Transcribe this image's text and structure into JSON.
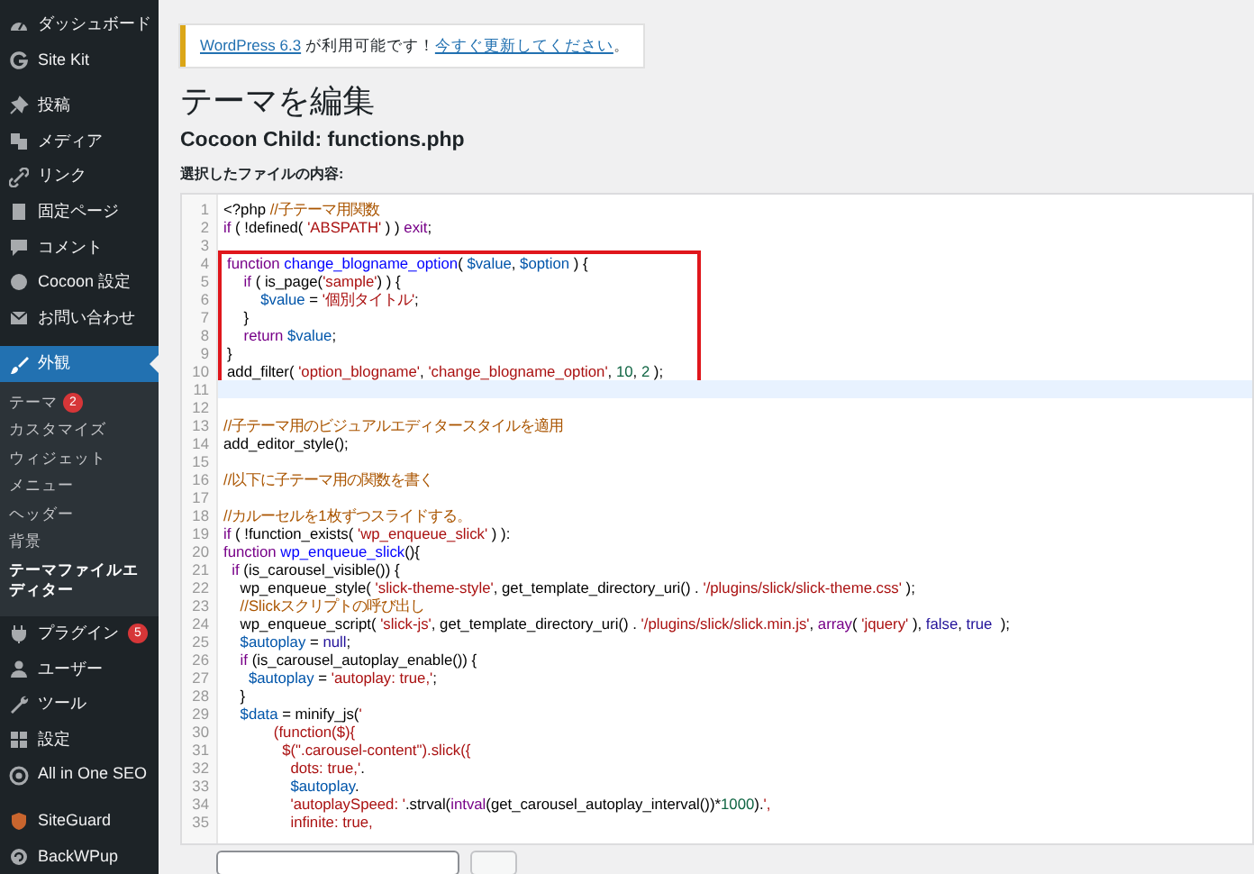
{
  "sidebar": {
    "groups": [
      {
        "items": [
          {
            "label": "ダッシュボード",
            "selected": false
          },
          {
            "label": "Site Kit",
            "selected": false
          }
        ]
      },
      {
        "items": [
          {
            "label": "投稿",
            "selected": false
          },
          {
            "label": "メディア",
            "selected": false
          },
          {
            "label": "リンク",
            "selected": false
          },
          {
            "label": "固定ページ",
            "selected": false
          },
          {
            "label": "コメント",
            "selected": false
          },
          {
            "label": "Cocoon 設定",
            "selected": false
          },
          {
            "label": "お問い合わせ",
            "selected": false
          }
        ]
      },
      {
        "items": [
          {
            "label": "外観",
            "selected": true,
            "children": [
              {
                "label": "テーマ",
                "badge": "2",
                "selected": false
              },
              {
                "label": "カスタマイズ",
                "selected": false
              },
              {
                "label": "ウィジェット",
                "selected": false
              },
              {
                "label": "メニュー",
                "selected": false
              },
              {
                "label": "ヘッダー",
                "selected": false
              },
              {
                "label": "背景",
                "selected": false
              },
              {
                "label": "テーマファイルエディター",
                "selected": true
              }
            ]
          },
          {
            "label": "プラグイン",
            "badge": "5",
            "selected": false
          },
          {
            "label": "ユーザー",
            "selected": false
          },
          {
            "label": "ツール",
            "selected": false
          },
          {
            "label": "設定",
            "selected": false
          },
          {
            "label": "All in One SEO",
            "selected": false
          }
        ]
      },
      {
        "items": [
          {
            "label": "SiteGuard",
            "selected": false
          },
          {
            "label": "BackWPup",
            "selected": false
          }
        ]
      }
    ]
  },
  "notice": {
    "parts": [
      {
        "text": "WordPress 6.3",
        "kind": "link"
      },
      {
        "text": " が利用可能です！",
        "kind": "text"
      },
      {
        "text": "今すぐ更新してください",
        "kind": "link"
      },
      {
        "text": "。",
        "kind": "text"
      }
    ]
  },
  "title": "テーマを編集",
  "file_heading": "Cocoon Child: functions.php",
  "content_label": "選択したファイルの内容:",
  "code": {
    "segments": [
      {
        "kind": "plain",
        "lines": [
          {
            "number": "1",
            "tokens": [
              {
                "text": "<?php ",
                "kind": "plain"
              },
              {
                "text": "//子テーマ用関数",
                "kind": "comment"
              }
            ]
          },
          {
            "number": "2",
            "tokens": [
              {
                "text": "if",
                "kind": "keyword"
              },
              {
                "text": " ( !defined( ",
                "kind": "plain"
              },
              {
                "text": "'ABSPATH'",
                "kind": "string"
              },
              {
                "text": " ) ) ",
                "kind": "plain"
              },
              {
                "text": "exit",
                "kind": "keyword"
              },
              {
                "text": ";",
                "kind": "plain"
              }
            ]
          },
          {
            "number": "3"
          }
        ]
      },
      {
        "kind": "highlight",
        "lines": [
          {
            "number": "4",
            "tokens": [
              {
                "text": "function",
                "kind": "keyword"
              },
              {
                "text": " change_blogname_option",
                "kind": "def"
              },
              {
                "text": "( ",
                "kind": "plain"
              },
              {
                "text": "$value",
                "kind": "variable"
              },
              {
                "text": ", ",
                "kind": "plain"
              },
              {
                "text": "$option",
                "kind": "variable"
              },
              {
                "text": " ) {",
                "kind": "plain"
              }
            ]
          },
          {
            "number": "5",
            "tokens": [
              {
                "text": "    if",
                "kind": "keyword"
              },
              {
                "text": " ( is_page(",
                "kind": "plain"
              },
              {
                "text": "'sample'",
                "kind": "string"
              },
              {
                "text": ") ) {",
                "kind": "plain"
              }
            ]
          },
          {
            "number": "6",
            "tokens": [
              {
                "text": "        $value",
                "kind": "variable"
              },
              {
                "text": " = ",
                "kind": "plain"
              },
              {
                "text": "'個別タイトル'",
                "kind": "string"
              },
              {
                "text": ";",
                "kind": "plain"
              }
            ]
          },
          {
            "number": "7",
            "tokens": [
              {
                "text": "    }",
                "kind": "plain"
              }
            ]
          },
          {
            "number": "8",
            "tokens": [
              {
                "text": "    return",
                "kind": "keyword"
              },
              {
                "text": " $value",
                "kind": "variable"
              },
              {
                "text": ";",
                "kind": "plain"
              }
            ]
          },
          {
            "number": "9",
            "tokens": [
              {
                "text": "}",
                "kind": "plain"
              }
            ]
          },
          {
            "number": "10",
            "tokens": [
              {
                "text": "add_filter( ",
                "kind": "plain"
              },
              {
                "text": "'option_blogname'",
                "kind": "string"
              },
              {
                "text": ", ",
                "kind": "plain"
              },
              {
                "text": "'change_blogname_option'",
                "kind": "string"
              },
              {
                "text": ", ",
                "kind": "plain"
              },
              {
                "text": "10",
                "kind": "number"
              },
              {
                "text": ", ",
                "kind": "plain"
              },
              {
                "text": "2",
                "kind": "number"
              },
              {
                "text": " );",
                "kind": "plain"
              }
            ]
          }
        ]
      },
      {
        "kind": "cursor",
        "lines": [
          {
            "number": "11"
          }
        ]
      },
      {
        "kind": "plain",
        "lines": [
          {
            "number": "12"
          },
          {
            "number": "13",
            "tokens": [
              {
                "text": "//子テーマ用のビジュアルエディタースタイルを適用",
                "kind": "comment"
              }
            ]
          },
          {
            "number": "14",
            "tokens": [
              {
                "text": "add_editor_style();",
                "kind": "plain"
              }
            ]
          },
          {
            "number": "15"
          },
          {
            "number": "16",
            "tokens": [
              {
                "text": "//以下に子テーマ用の関数を書く",
                "kind": "comment"
              }
            ]
          },
          {
            "number": "17"
          },
          {
            "number": "18",
            "tokens": [
              {
                "text": "//カルーセルを1枚ずつスライドする。",
                "kind": "comment"
              }
            ]
          },
          {
            "number": "19",
            "tokens": [
              {
                "text": "if",
                "kind": "keyword"
              },
              {
                "text": " ( !function_exists( ",
                "kind": "plain"
              },
              {
                "text": "'wp_enqueue_slick'",
                "kind": "string"
              },
              {
                "text": " ) ):",
                "kind": "plain"
              }
            ]
          },
          {
            "number": "20",
            "tokens": [
              {
                "text": "function",
                "kind": "keyword"
              },
              {
                "text": " wp_enqueue_slick",
                "kind": "def"
              },
              {
                "text": "(){",
                "kind": "plain"
              }
            ]
          },
          {
            "number": "21",
            "tokens": [
              {
                "text": "  if",
                "kind": "keyword"
              },
              {
                "text": " (is_carousel_visible()) {",
                "kind": "plain"
              }
            ]
          },
          {
            "number": "22",
            "tokens": [
              {
                "text": "    wp_enqueue_style( ",
                "kind": "plain"
              },
              {
                "text": "'slick-theme-style'",
                "kind": "string"
              },
              {
                "text": ", get_template_directory_uri() . ",
                "kind": "plain"
              },
              {
                "text": "'/plugins/slick/slick-theme.css'",
                "kind": "string"
              },
              {
                "text": " );",
                "kind": "plain"
              }
            ]
          },
          {
            "number": "23",
            "tokens": [
              {
                "text": "    //Slickスクリプトの呼び出し",
                "kind": "comment"
              }
            ]
          },
          {
            "number": "24",
            "tokens": [
              {
                "text": "    wp_enqueue_script( ",
                "kind": "plain"
              },
              {
                "text": "'slick-js'",
                "kind": "string"
              },
              {
                "text": ", get_template_directory_uri() . ",
                "kind": "plain"
              },
              {
                "text": "'/plugins/slick/slick.min.js'",
                "kind": "string"
              },
              {
                "text": ", ",
                "kind": "plain"
              },
              {
                "text": "array",
                "kind": "keyword"
              },
              {
                "text": "( ",
                "kind": "plain"
              },
              {
                "text": "'jquery'",
                "kind": "string"
              },
              {
                "text": " ), ",
                "kind": "plain"
              },
              {
                "text": "false",
                "kind": "atom"
              },
              {
                "text": ", ",
                "kind": "plain"
              },
              {
                "text": "true",
                "kind": "atom"
              },
              {
                "text": "  );",
                "kind": "plain"
              }
            ]
          },
          {
            "number": "25",
            "tokens": [
              {
                "text": "    $autoplay",
                "kind": "variable"
              },
              {
                "text": " = ",
                "kind": "plain"
              },
              {
                "text": "null",
                "kind": "atom"
              },
              {
                "text": ";",
                "kind": "plain"
              }
            ]
          },
          {
            "number": "26",
            "tokens": [
              {
                "text": "    if",
                "kind": "keyword"
              },
              {
                "text": " (is_carousel_autoplay_enable()) {",
                "kind": "plain"
              }
            ]
          },
          {
            "number": "27",
            "tokens": [
              {
                "text": "      $autoplay",
                "kind": "variable"
              },
              {
                "text": " = ",
                "kind": "plain"
              },
              {
                "text": "'autoplay: true,'",
                "kind": "string"
              },
              {
                "text": ";",
                "kind": "plain"
              }
            ]
          },
          {
            "number": "28",
            "tokens": [
              {
                "text": "    }",
                "kind": "plain"
              }
            ]
          },
          {
            "number": "29",
            "tokens": [
              {
                "text": "    $data",
                "kind": "variable"
              },
              {
                "text": " = minify_js(",
                "kind": "plain"
              },
              {
                "text": "'",
                "kind": "string"
              }
            ]
          },
          {
            "number": "30",
            "tokens": [
              {
                "text": "            (function($){",
                "kind": "string"
              }
            ]
          },
          {
            "number": "31",
            "tokens": [
              {
                "text": "              $(\".carousel-content\").slick({",
                "kind": "string"
              }
            ]
          },
          {
            "number": "32",
            "tokens": [
              {
                "text": "                dots: true,'",
                "kind": "string"
              },
              {
                "text": ".",
                "kind": "plain"
              }
            ]
          },
          {
            "number": "33",
            "tokens": [
              {
                "text": "                $autoplay",
                "kind": "variable"
              },
              {
                "text": ".",
                "kind": "plain"
              }
            ]
          },
          {
            "number": "34",
            "tokens": [
              {
                "text": "                'autoplaySpeed: '",
                "kind": "string"
              },
              {
                "text": ".strval(",
                "kind": "plain"
              },
              {
                "text": "intval",
                "kind": "keyword"
              },
              {
                "text": "(get_carousel_autoplay_interval())*",
                "kind": "plain"
              },
              {
                "text": "1000",
                "kind": "number"
              },
              {
                "text": ").",
                "kind": "plain"
              },
              {
                "text": "',",
                "kind": "string"
              }
            ]
          },
          {
            "number": "35",
            "tokens": [
              {
                "text": "                infinite: true,",
                "kind": "string"
              }
            ]
          }
        ]
      }
    ]
  }
}
